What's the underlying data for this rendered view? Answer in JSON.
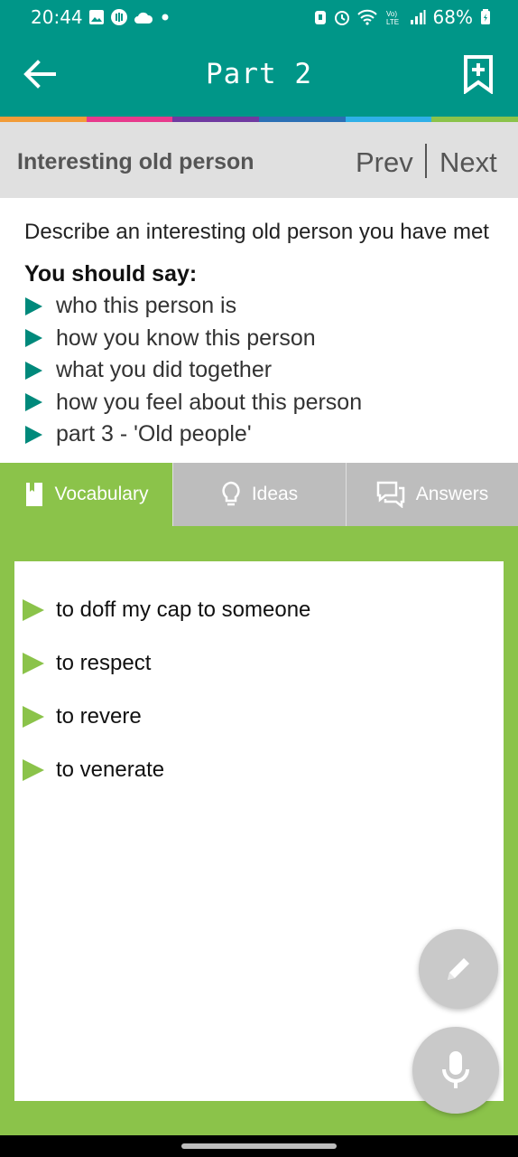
{
  "status_bar": {
    "time": "20:44",
    "battery": "68%",
    "left_icons": [
      "gallery-icon",
      "podcast-icon",
      "cloud-icon",
      "dot-icon"
    ],
    "right_icons": [
      "shield-icon",
      "alarm-icon",
      "wifi-icon",
      "volte-icon",
      "signal-icon",
      "battery-icon"
    ]
  },
  "app_bar": {
    "title": "Part 2",
    "background": "#009688"
  },
  "color_strip": [
    "#f29c38",
    "#e73a8d",
    "#6f3aa1",
    "#2b6fb5",
    "#2fb0e8",
    "#8bc34a"
  ],
  "nav_header": {
    "title": "Interesting old person",
    "prev_label": "Prev",
    "next_label": "Next"
  },
  "prompt": {
    "heading": "Describe an interesting old person you have met",
    "say_label": "You should say:",
    "items": [
      "who this person is",
      "how you know this person",
      "what you did together",
      "how you feel about this person",
      "part 3 - 'Old people'"
    ]
  },
  "tabs": [
    {
      "label": "Vocabulary",
      "icon": "bookmark-icon",
      "active": true
    },
    {
      "label": "Ideas",
      "icon": "lightbulb-icon",
      "active": false
    },
    {
      "label": "Answers",
      "icon": "chat-icon",
      "active": false
    }
  ],
  "vocabulary": [
    "to doff my cap to someone",
    "to respect",
    "to revere",
    "to venerate"
  ],
  "accent_green": "#8bc34a",
  "accent_teal": "#00897b"
}
